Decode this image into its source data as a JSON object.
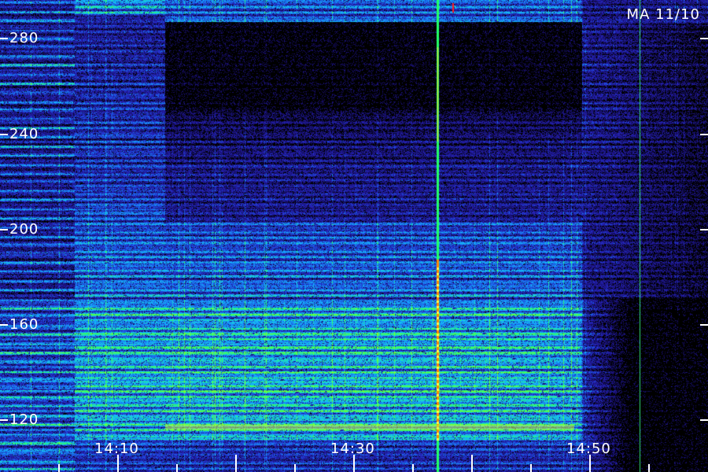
{
  "header": {
    "station_date": "MA 11/10"
  },
  "axes": {
    "y_ticks": [
      "280",
      "240",
      "200",
      "160",
      "120"
    ],
    "x_ticks": [
      "14:10",
      "14:30",
      "14:50"
    ]
  },
  "colors": {
    "background": "#000000",
    "low": "#1a1aa0",
    "mid": "#22a8ff",
    "high": "#33ff66",
    "peak": "#ff9900",
    "text": "#ffffff"
  }
}
